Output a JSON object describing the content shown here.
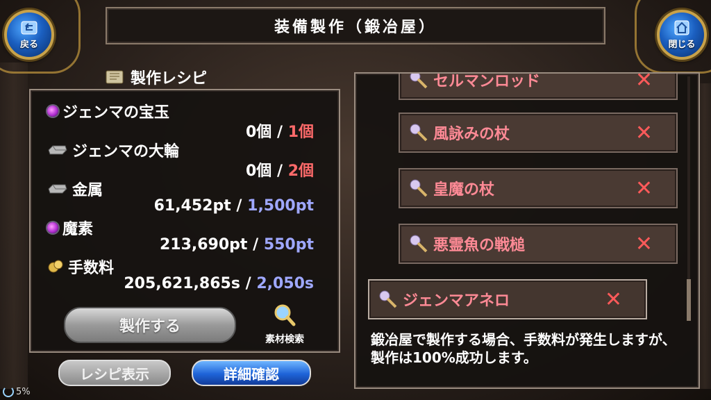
{
  "header": {
    "title": "装備製作（鍛冶屋）",
    "back_label": "戻る",
    "close_label": "閉じる"
  },
  "recipe": {
    "heading": "製作レシピ",
    "materials": [
      {
        "icon": "purple-gem-icon",
        "name": "ジェンマの宝玉",
        "have": "0個",
        "sep": "/",
        "need": "1個"
      },
      {
        "icon": "iron-ingot-icon",
        "name": "ジェンマの大輪",
        "have": "0個",
        "sep": "/",
        "need": "2個"
      },
      {
        "icon": "iron-ingot-icon",
        "name": "金属",
        "have": "61,452pt",
        "sep": "/",
        "need": "1,500pt"
      },
      {
        "icon": "purple-gem-icon",
        "name": "魔素",
        "have": "213,690pt",
        "sep": "/",
        "need": "550pt"
      },
      {
        "icon": "coin-icon",
        "name": "手数料",
        "have": "205,621,865s",
        "sep": "/",
        "need": "2,050s"
      }
    ],
    "make_button": "製作する",
    "search_label": "素材検索",
    "show_recipe_button": "レシピ表示",
    "detail_button": "詳細確認"
  },
  "equipment_list": {
    "items": [
      {
        "name": "セルマンロッド",
        "icon": "wand-icon",
        "mark": "✕"
      },
      {
        "name": "風詠みの杖",
        "icon": "wand-icon",
        "mark": "✕"
      },
      {
        "name": "皇魔の杖",
        "icon": "wand-icon",
        "mark": "✕"
      },
      {
        "name": "悪霊魚の戦槌",
        "icon": "wand-icon",
        "mark": "✕"
      },
      {
        "name": "ジェンマアネロ",
        "icon": "wand-icon",
        "mark": "✕",
        "selected": true
      }
    ]
  },
  "info": {
    "text": "鍛冶屋で製作する場合、手数料が発生しますが、製作は100%成功します。"
  },
  "status": {
    "loading": "5%"
  },
  "colors": {
    "need_red": "#ff6a6a",
    "need_blue": "#9fa8ff",
    "item_name": "#ff8a96",
    "mark": "#ff5a5a"
  }
}
